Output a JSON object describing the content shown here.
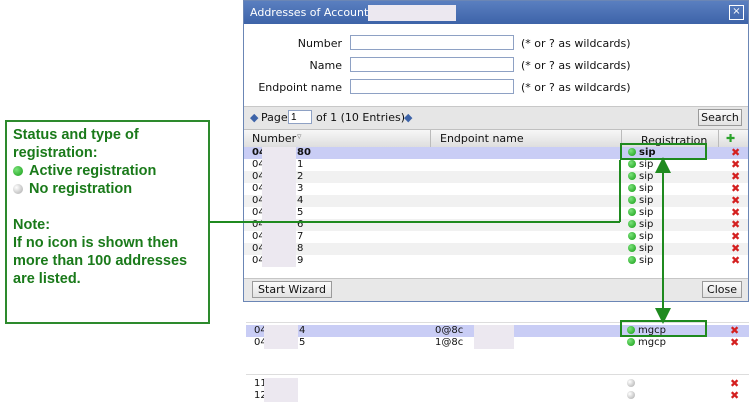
{
  "dialog": {
    "title": "Addresses of Account: 2",
    "close_glyph": "×",
    "filters": [
      {
        "label": "Number",
        "value": "",
        "hint": "(* or ? as wildcards)"
      },
      {
        "label": "Name",
        "value": "",
        "hint": "(* or ? as wildcards)"
      },
      {
        "label": "Endpoint name",
        "value": "",
        "hint": "(* or ? as wildcards)"
      }
    ],
    "pager": {
      "prev": "◆",
      "page_label": "Page",
      "page_value": "1",
      "of_text": "of 1 (10 Entries)",
      "next": "◆",
      "search_label": "Search"
    },
    "columns": {
      "number": "Number",
      "sort_glyph": "▿",
      "endpoint": "Endpoint name",
      "registration": "Registration",
      "add_glyph": "✚"
    },
    "rows": [
      {
        "num_start": "04",
        "num_end": "80",
        "reg": "sip"
      },
      {
        "num_start": "04",
        "num_end": "1",
        "reg": "sip"
      },
      {
        "num_start": "04",
        "num_end": "2",
        "reg": "sip"
      },
      {
        "num_start": "04",
        "num_end": "3",
        "reg": "sip"
      },
      {
        "num_start": "04",
        "num_end": "4",
        "reg": "sip"
      },
      {
        "num_start": "04",
        "num_end": "5",
        "reg": "sip"
      },
      {
        "num_start": "04",
        "num_end": "6",
        "reg": "sip"
      },
      {
        "num_start": "04",
        "num_end": "7",
        "reg": "sip"
      },
      {
        "num_start": "04",
        "num_end": "8",
        "reg": "sip"
      },
      {
        "num_start": "04",
        "num_end": "9",
        "reg": "sip"
      }
    ],
    "delete_glyph": "✖",
    "start_wizard_label": "Start Wizard",
    "close_label": "Close"
  },
  "fragment_mgcp": [
    {
      "num_start": "04",
      "num_end": "4",
      "endpoint": "0@8c",
      "endpoint_end": "",
      "reg": "mgcp"
    },
    {
      "num_start": "04",
      "num_end": "5",
      "endpoint": "1@8c",
      "endpoint_end": "",
      "reg": "mgcp"
    }
  ],
  "fragment_none": [
    {
      "num_start": "11",
      "reg": ""
    },
    {
      "num_start": "12",
      "reg": ""
    }
  ],
  "note": {
    "heading": "Status and type of registration:",
    "active": "Active registration",
    "none": "No registration",
    "note_title": "Note:",
    "note_text": "If no icon is shown then more than 100 addresses are listed."
  },
  "colors": {
    "accent_green": "#1f8a1f",
    "titlebar": "#4a70b4",
    "selected_row": "#c9cdf5",
    "delete_red": "#d42020"
  }
}
